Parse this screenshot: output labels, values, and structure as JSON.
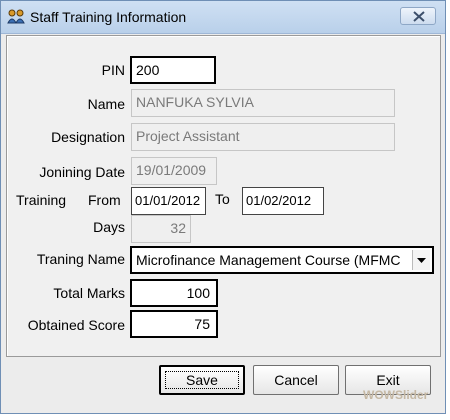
{
  "window": {
    "title": "Staff Training Information"
  },
  "form": {
    "pin_label": "PIN",
    "pin_value": "200",
    "name_label": "Name",
    "name_value": "NANFUKA SYLVIA",
    "designation_label": "Designation",
    "designation_value": "Project Assistant",
    "joining_date_label": "Jonining Date",
    "joining_date_value": "19/01/2009",
    "training_label": "Training",
    "from_label": "From",
    "from_value": "01/01/2012",
    "to_label": "To",
    "to_value": "01/02/2012",
    "days_label": "Days",
    "days_value": "32",
    "training_name_label": "Traning Name",
    "training_name_value": "Microfinance Management Course (MFMC",
    "total_marks_label": "Total Marks",
    "total_marks_value": "100",
    "obtained_score_label": "Obtained Score",
    "obtained_score_value": "75"
  },
  "buttons": {
    "save": "Save",
    "cancel": "Cancel",
    "exit": "Exit"
  },
  "watermark": "WOWSlider"
}
